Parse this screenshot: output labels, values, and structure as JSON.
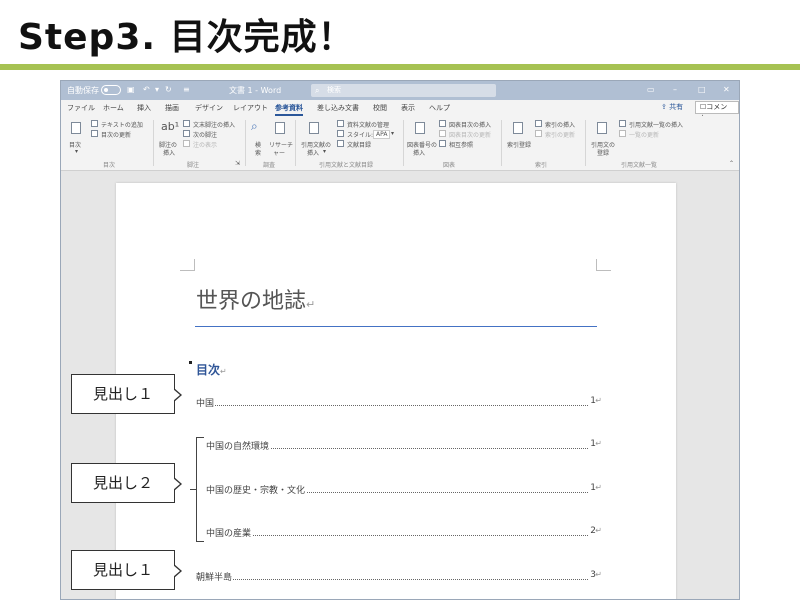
{
  "slide": {
    "title": "Step3. 目次完成！"
  },
  "window": {
    "autosave_label": "自動保存",
    "document_title": "文書 1 - Word",
    "search_placeholder": "検索",
    "tabs": [
      "ファイル",
      "ホーム",
      "挿入",
      "描画",
      "デザイン",
      "レイアウト",
      "参考資料",
      "差し込み文書",
      "校閲",
      "表示",
      "ヘルプ"
    ],
    "active_tab": "参考資料",
    "share_label": "共有",
    "comment_label": "コメント"
  },
  "ribbon": {
    "toc_button": "目次",
    "add_text": "テキストの追加",
    "update_toc": "目次の更新",
    "group_toc": "目次",
    "insert_footnote_line1": "脚注の",
    "insert_footnote_line2": "挿入",
    "insert_endnote": "文末脚注の挿入",
    "next_footnote": "次の脚注",
    "show_notes": "注の表示",
    "group_footnote": "脚注",
    "search_line1": "検",
    "search_line2": "索",
    "researcher_line1": "リサーチ",
    "researcher_line2": "ャー",
    "group_research": "調査",
    "insert_citation_line1": "引用文献の",
    "insert_citation_line2": "挿入",
    "manage_sources": "資料文献の管理",
    "style_label": "スタイル:",
    "style_value": "APA",
    "bibliography": "文献目録",
    "group_citations": "引用文献と文献目録",
    "insert_caption_line1": "図表番号の",
    "insert_caption_line2": "挿入",
    "insert_table_of_figures": "図表目次の挿入",
    "update_table": "図表目次の更新",
    "cross_reference": "相互参照",
    "group_captions": "図表",
    "mark_entry": "索引登録",
    "insert_index": "索引の挿入",
    "update_index": "索引の更新",
    "group_index": "索引",
    "mark_citation_line1": "引用文の",
    "mark_citation_line2": "登録",
    "insert_table_of_authorities": "引用文献一覧の挿入",
    "update_table_of_authorities": "一覧の更新",
    "group_authorities": "引用文献一覧"
  },
  "document": {
    "title": "世界の地誌",
    "para_mark": "↵",
    "toc_heading": "目次",
    "toc_entries": [
      {
        "text": "中国",
        "page": "1"
      },
      {
        "text": "中国の自然環境",
        "page": "1"
      },
      {
        "text": "中国の歴史・宗教・文化",
        "page": "1"
      },
      {
        "text": "中国の産業",
        "page": "2"
      },
      {
        "text": "朝鮮半島",
        "page": "3"
      }
    ]
  },
  "callouts": {
    "heading1_top": "見出し１",
    "heading2": "見出し２",
    "heading1_bottom": "見出し１"
  }
}
